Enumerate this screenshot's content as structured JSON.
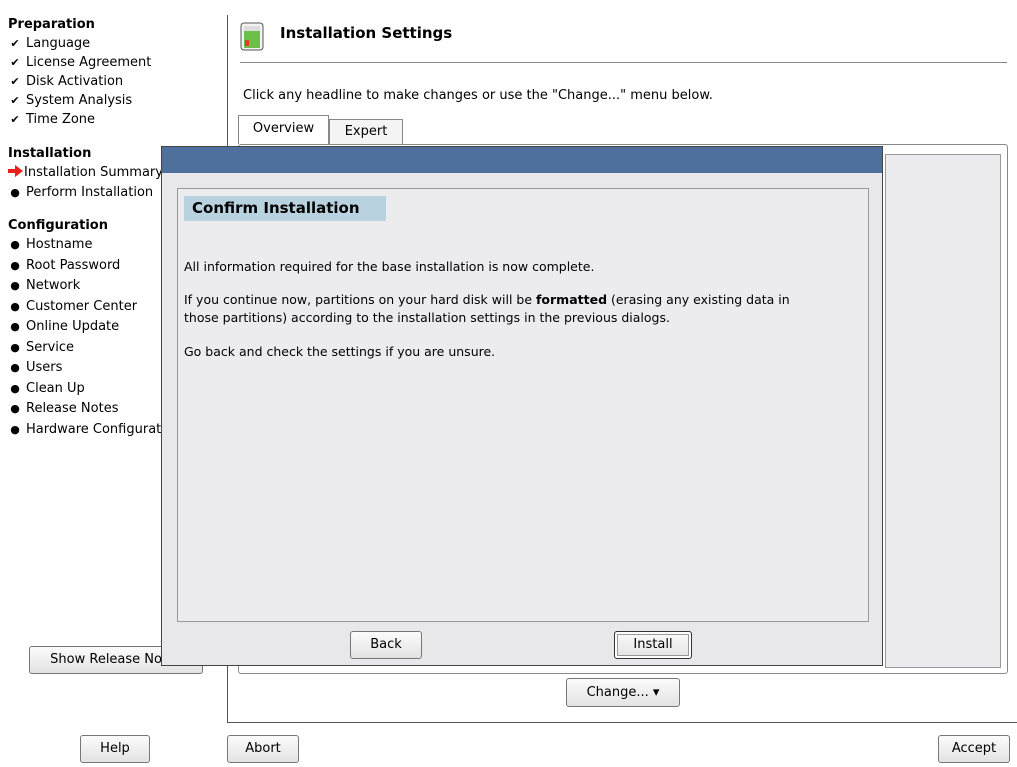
{
  "sidebar": {
    "preparation": {
      "heading": "Preparation",
      "items": [
        "Language",
        "License Agreement",
        "Disk Activation",
        "System Analysis",
        "Time Zone"
      ]
    },
    "installation": {
      "heading": "Installation",
      "items": [
        "Installation Summary",
        "Perform Installation"
      ]
    },
    "configuration": {
      "heading": "Configuration",
      "items": [
        "Hostname",
        "Root Password",
        "Network",
        "Customer Center",
        "Online Update",
        "Service",
        "Users",
        "Clean Up",
        "Release Notes",
        "Hardware Configuration"
      ]
    },
    "show_release_notes": "Show Release Notes",
    "check_glyph": "✔",
    "bullet_glyph": "●"
  },
  "main": {
    "title": "Installation Settings",
    "hint": "Click any headline to make changes or use the \"Change...\" menu below.",
    "tabs": [
      "Overview",
      "Expert"
    ],
    "change_button": "Change...",
    "change_arrow": "▾"
  },
  "dialog": {
    "title": "Confirm Installation",
    "line1": "All information required for the base installation is now complete.",
    "line2_before": "If you continue now, partitions on your hard disk will be ",
    "line2_bold": "formatted",
    "line2_after": " (erasing any existing data in",
    "line3": "those partitions) according to the installation settings in the previous dialogs.",
    "line4": "Go back and check the settings if you are unsure.",
    "back_button": "Back",
    "install_button": "Install"
  },
  "footer": {
    "help": "Help",
    "abort": "Abort",
    "accept": "Accept"
  },
  "colors": {
    "titlebar": "#4f6f9c",
    "confirm_title_bg": "#b9d2e0",
    "arrow": "#e8201b",
    "dialog_bg": "#e8e8ea"
  },
  "icons": {
    "title_icon": "installation-settings-icon",
    "current_step": "red-arrow-icon"
  }
}
